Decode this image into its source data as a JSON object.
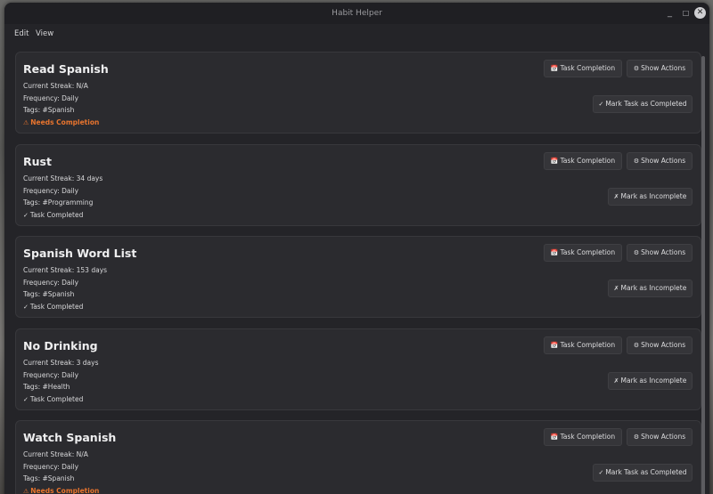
{
  "window": {
    "title": "Habit Helper"
  },
  "menu": {
    "edit": "Edit",
    "view": "View"
  },
  "controls": {
    "minimize": "_",
    "maximize": "□",
    "close": "✕"
  },
  "labels": {
    "task_completion": "Task Completion",
    "show_actions": "Show Actions",
    "mark_completed": "Mark Task as Completed",
    "mark_incomplete": "Mark as Incomplete",
    "needs_completion": "Needs Completion",
    "task_completed": "Task Completed"
  },
  "icons": {
    "calendar": "📅",
    "gear": "⚙",
    "check": "✓",
    "cross": "✗",
    "warning": "⚠"
  },
  "colors": {
    "accent_warning": "#e8742e",
    "background": "#242428",
    "card": "#2b2b2f"
  },
  "habits": [
    {
      "name": "Read Spanish",
      "streak": "Current Streak: N/A",
      "frequency": "Frequency: Daily",
      "tags": "Tags:  #Spanish",
      "status": "Needs Completion",
      "completed": false
    },
    {
      "name": "Rust",
      "streak": "Current Streak: 34 days",
      "frequency": "Frequency: Daily",
      "tags": "Tags:  #Programming",
      "status": "Task Completed",
      "completed": true
    },
    {
      "name": "Spanish Word List",
      "streak": "Current Streak: 153 days",
      "frequency": "Frequency: Daily",
      "tags": "Tags:  #Spanish",
      "status": "Task Completed",
      "completed": true
    },
    {
      "name": "No Drinking",
      "streak": "Current Streak: 3 days",
      "frequency": "Frequency: Daily",
      "tags": "Tags:  #Health",
      "status": "Task Completed",
      "completed": true
    },
    {
      "name": "Watch Spanish",
      "streak": "Current Streak: N/A",
      "frequency": "Frequency: Daily",
      "tags": "Tags:  #Spanish",
      "status": "Needs Completion",
      "completed": false
    }
  ]
}
